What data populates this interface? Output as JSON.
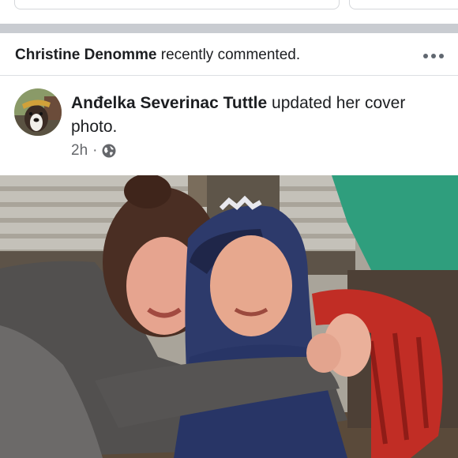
{
  "context": {
    "actor": "Christine Denomme",
    "action": "recently commented."
  },
  "post": {
    "author": "Anđelka Severinac Tuttle",
    "action_line1": "updated her cover",
    "action_line2": "photo.",
    "time": "2h",
    "separator": "·",
    "audience_icon": "globe-icon"
  },
  "more_icon": "more-horizontal-icon",
  "colors": {
    "separator": "#c9ccd1",
    "meta_text": "#65676b",
    "more_dots": "#606770"
  }
}
